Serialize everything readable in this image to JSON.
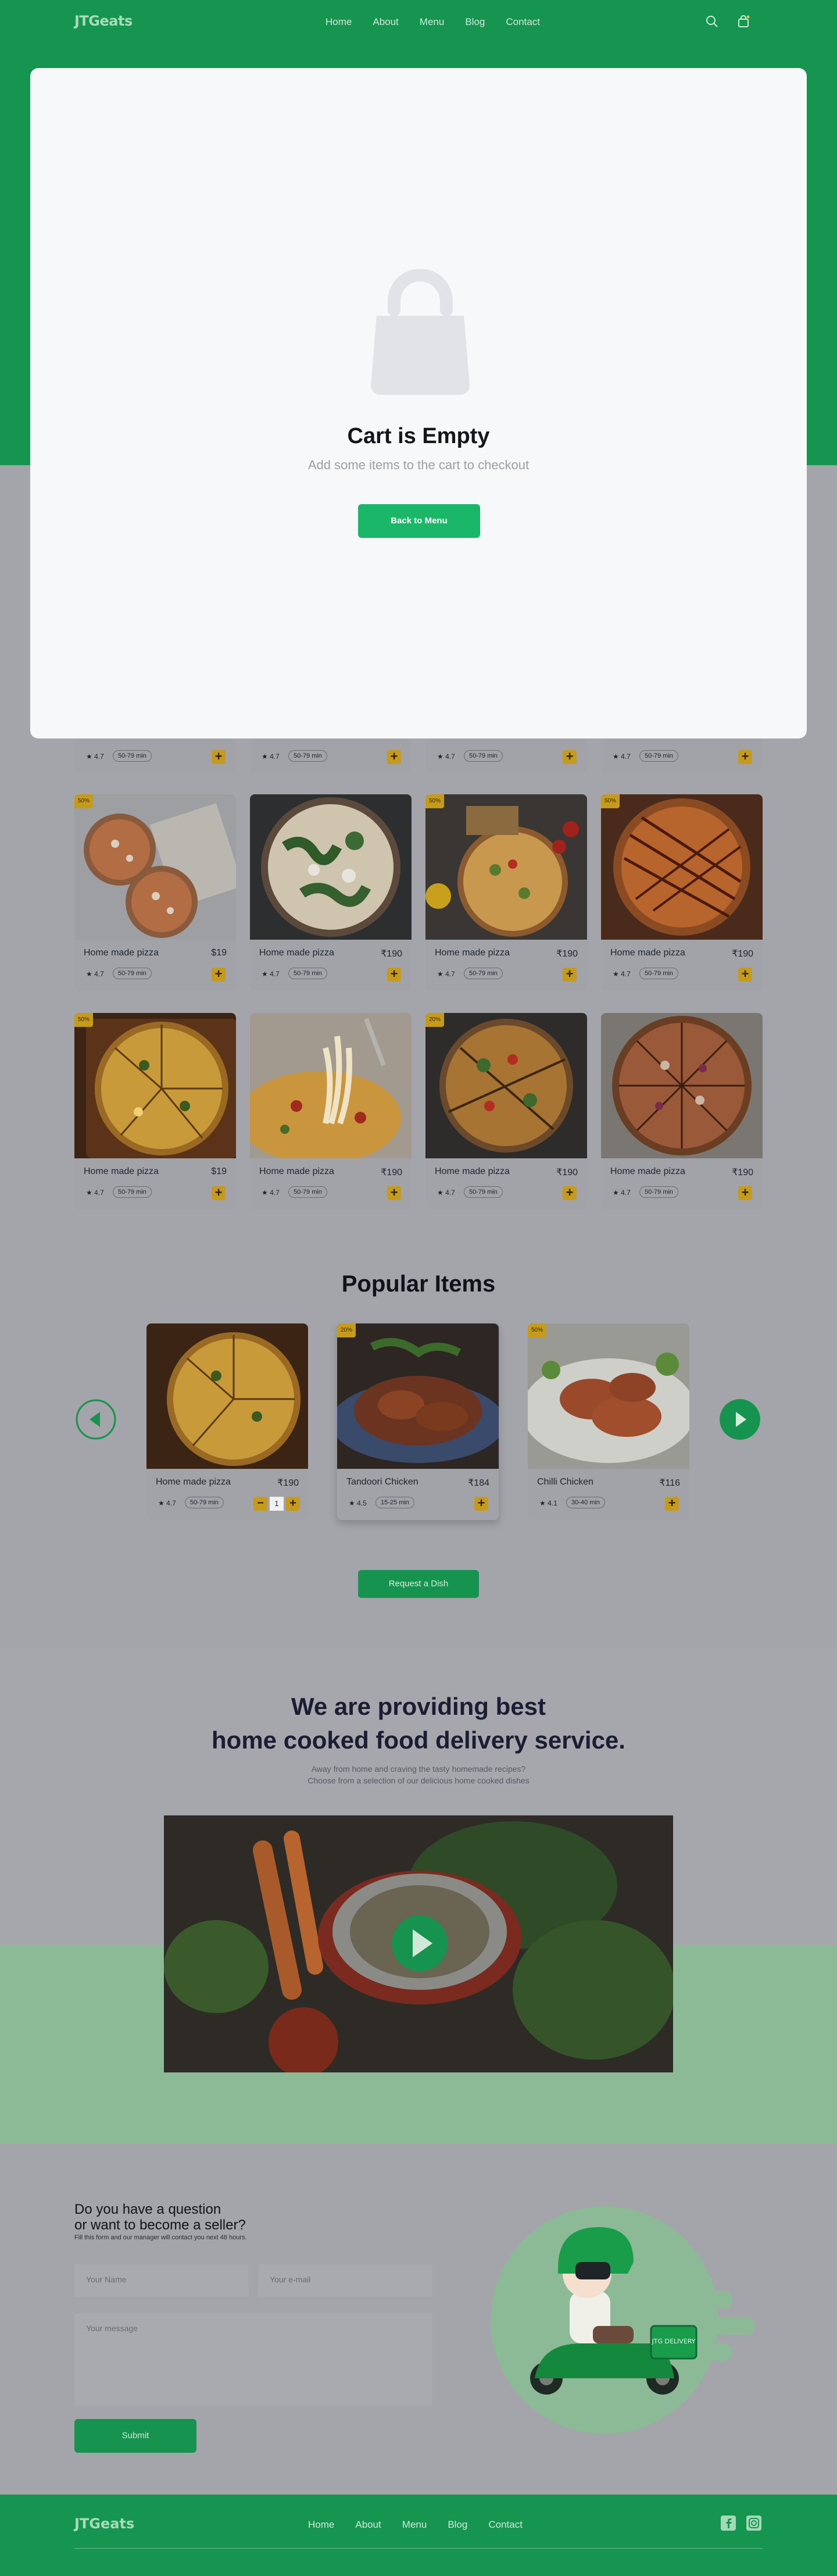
{
  "brand": {
    "logo": "JTGeats",
    "accent": "#169551",
    "cta": "#19b767",
    "badge": "#c69a1a"
  },
  "nav": {
    "items": [
      "Home",
      "About",
      "Menu",
      "Blog",
      "Contact"
    ],
    "search_icon": "search-icon",
    "cart_icon": "shopping-bag-icon"
  },
  "modal": {
    "icon": "shopping-bag-icon",
    "title": "Cart is Empty",
    "subtitle": "Add some items to the cart to checkout",
    "button": "Back to Menu"
  },
  "grid": {
    "peek_row": [
      {
        "rating": "4.7",
        "time": "50-79 min"
      },
      {
        "rating": "4.7",
        "time": "50-79 min"
      },
      {
        "rating": "4.7",
        "time": "50-79 min"
      },
      {
        "rating": "4.7",
        "time": "50-79 min"
      }
    ],
    "rows": [
      [
        {
          "badge": "50%",
          "name": "Home made pizza",
          "price": "$19",
          "rating": "4.7",
          "time": "50-79 min"
        },
        {
          "badge": "",
          "name": "Home made pizza",
          "price": "₹190",
          "rating": "4.7",
          "time": "50-79 min"
        },
        {
          "badge": "50%",
          "name": "Home made pizza",
          "price": "₹190",
          "rating": "4.7",
          "time": "50-79 min"
        },
        {
          "badge": "50%",
          "name": "Home made pizza",
          "price": "₹190",
          "rating": "4.7",
          "time": "50-79 min"
        }
      ],
      [
        {
          "badge": "50%",
          "name": "Home made pizza",
          "price": "$19",
          "rating": "4.7",
          "time": "50-79 min"
        },
        {
          "badge": "",
          "name": "Home made pizza",
          "price": "₹190",
          "rating": "4.7",
          "time": "50-79 min"
        },
        {
          "badge": "20%",
          "name": "Home made pizza",
          "price": "₹190",
          "rating": "4.7",
          "time": "50-79 min"
        },
        {
          "badge": "",
          "name": "Home made pizza",
          "price": "₹190",
          "rating": "4.7",
          "time": "50-79 min"
        }
      ]
    ]
  },
  "popular": {
    "title": "Popular Items",
    "items": [
      {
        "badge": "",
        "name": "Home made pizza",
        "price": "₹190",
        "rating": "4.7",
        "time": "50-79 min",
        "qty": "1"
      },
      {
        "badge": "20%",
        "name": "Tandoori Chicken",
        "price": "₹184",
        "rating": "4.5",
        "time": "15-25 min"
      },
      {
        "badge": "50%",
        "name": "Chilli Chicken",
        "price": "₹116",
        "rating": "4.1",
        "time": "30-40 min"
      }
    ],
    "request_button": "Request a Dish"
  },
  "service": {
    "title_line1": "We are providing best",
    "title_line2": "home cooked food delivery service.",
    "sub_line1": "Away from home and craving the tasty homemade recipes?",
    "sub_line2": "Choose from a selection of our delicious home cooked dishes"
  },
  "contact": {
    "title_line1": "Do you have a question",
    "title_line2": "or want to become a seller?",
    "note": "Fill this form and our manager will contact you next 48 hours.",
    "name_placeholder": "Your Name",
    "email_placeholder": "Your e-mail",
    "message_placeholder": "Your message",
    "submit": "Submit",
    "scooter_box": "JTG DELIVERY"
  },
  "footer": {
    "logo": "JTGeats",
    "links": [
      "Home",
      "About",
      "Menu",
      "Blog",
      "Contact"
    ],
    "icons": [
      "facebook-icon",
      "instagram-icon"
    ]
  }
}
